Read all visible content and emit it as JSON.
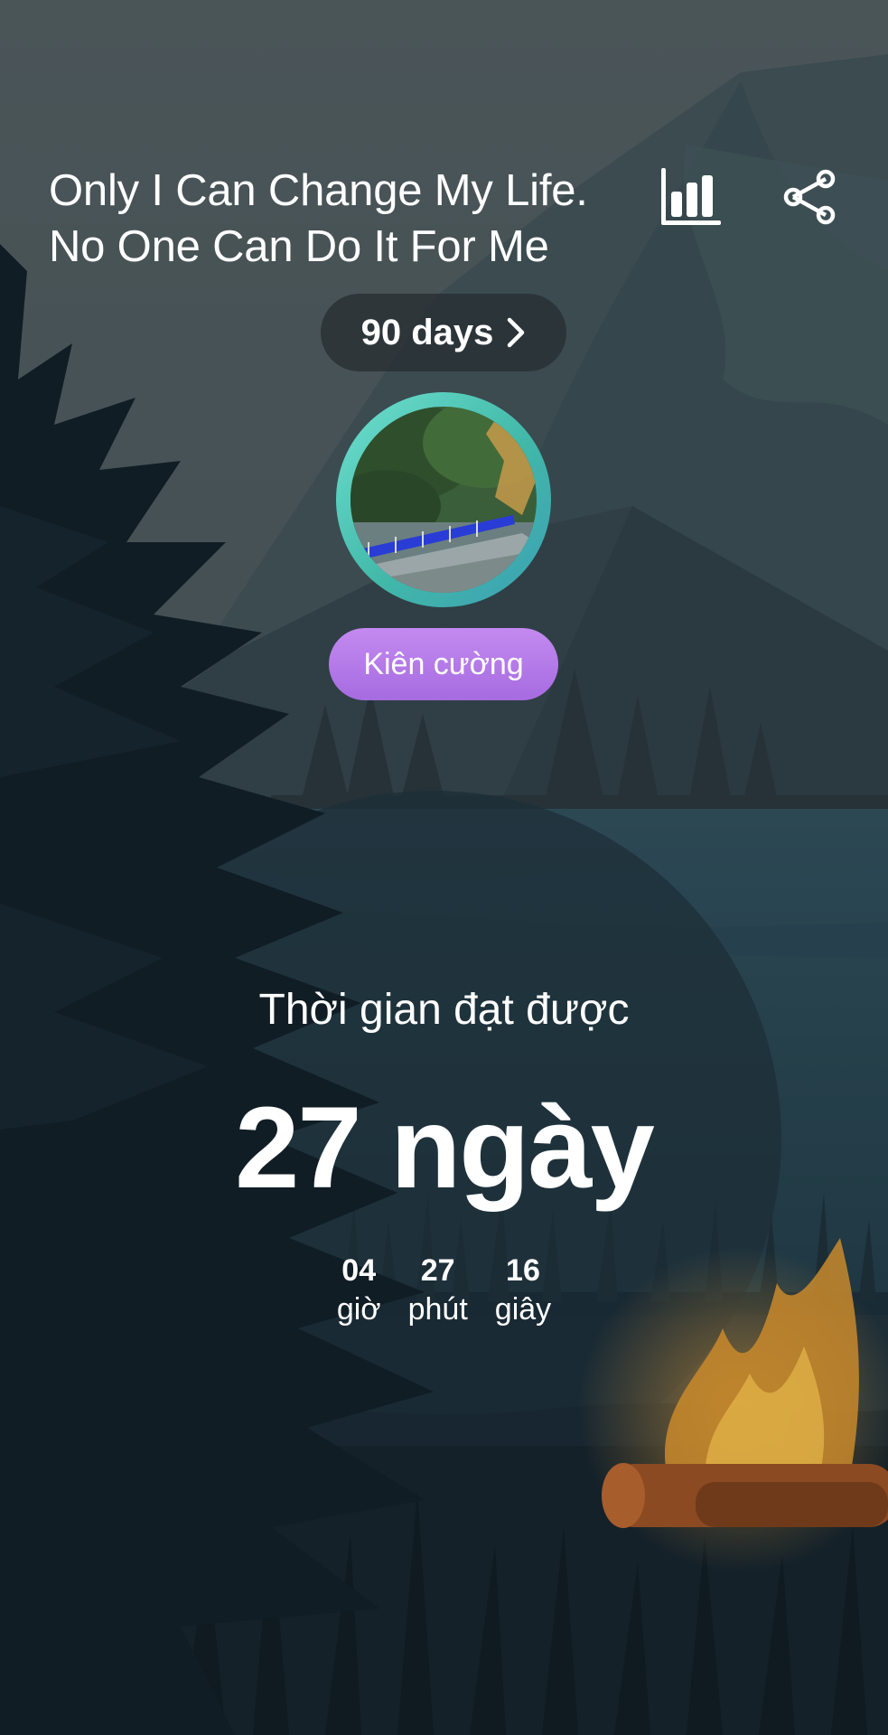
{
  "quote": {
    "line1": "Only I Can Change My Life.",
    "line2": "No One Can Do It For Me"
  },
  "header": {
    "stats_icon": "bar-chart-icon",
    "share_icon": "share-icon"
  },
  "goal": {
    "label": "90 days",
    "chevron": "›"
  },
  "avatar": {
    "description_icon": "avatar-photo"
  },
  "badge": {
    "label": "Kiên cường"
  },
  "achievement": {
    "label": "Thời gian đạt được",
    "days_value": "27 ngày",
    "units": [
      {
        "value": "04",
        "label": "giờ"
      },
      {
        "value": "27",
        "label": "phút"
      },
      {
        "value": "16",
        "label": "giây"
      }
    ]
  },
  "colors": {
    "badge": "#b57ce8",
    "ring": "#5fd3c4",
    "pill": "#2b3337"
  }
}
